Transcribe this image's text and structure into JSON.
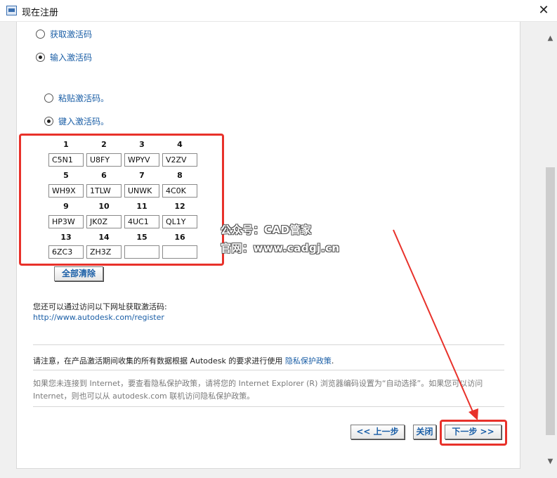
{
  "window": {
    "title": "现在注册",
    "close_glyph": "✕"
  },
  "radios": {
    "get_code": "获取激活码",
    "enter_code": "输入激活码",
    "paste_code": "粘贴激活码。",
    "type_code": "键入激活码。"
  },
  "grid": {
    "numbers": [
      "1",
      "2",
      "3",
      "4",
      "5",
      "6",
      "7",
      "8",
      "9",
      "10",
      "11",
      "12",
      "13",
      "14",
      "15",
      "16"
    ],
    "values": [
      "C5N1",
      "U8FY",
      "WPYV",
      "V2ZV",
      "WH9X",
      "1TLW",
      "UNWK",
      "4C0K",
      "HP3W",
      "JK0Z",
      "4UC1",
      "QL1Y",
      "6ZC3",
      "ZH3Z",
      "",
      ""
    ]
  },
  "clear_all": "全部清除",
  "watermark": {
    "line1": "公众号：CAD管家",
    "line2": "官网：www.cadgj.cn"
  },
  "info": {
    "visit_text": "您还可以通过访问以下网址获取激活码:",
    "visit_link": "http://www.autodesk.com/register",
    "notice_prefix": "请注意，在产品激活期间收集的所有数据根据 Autodesk 的要求进行使用",
    "privacy_link": "隐私保护政策",
    "notice_suffix": ".",
    "gray_line1": "如果您未连接到 Internet，要查看隐私保护政策，请将您的 Internet Explorer (R) 浏览器编码设置为“自动选择”。如果您可以访问",
    "gray_line2": "Internet，则也可以从 autodesk.com 联机访问隐私保护政策。"
  },
  "buttons": {
    "prev": "<< 上一步",
    "close": "关闭",
    "next": "下一步 >>"
  },
  "colors": {
    "highlight": "#e8312a",
    "link": "#1a5ea6"
  }
}
